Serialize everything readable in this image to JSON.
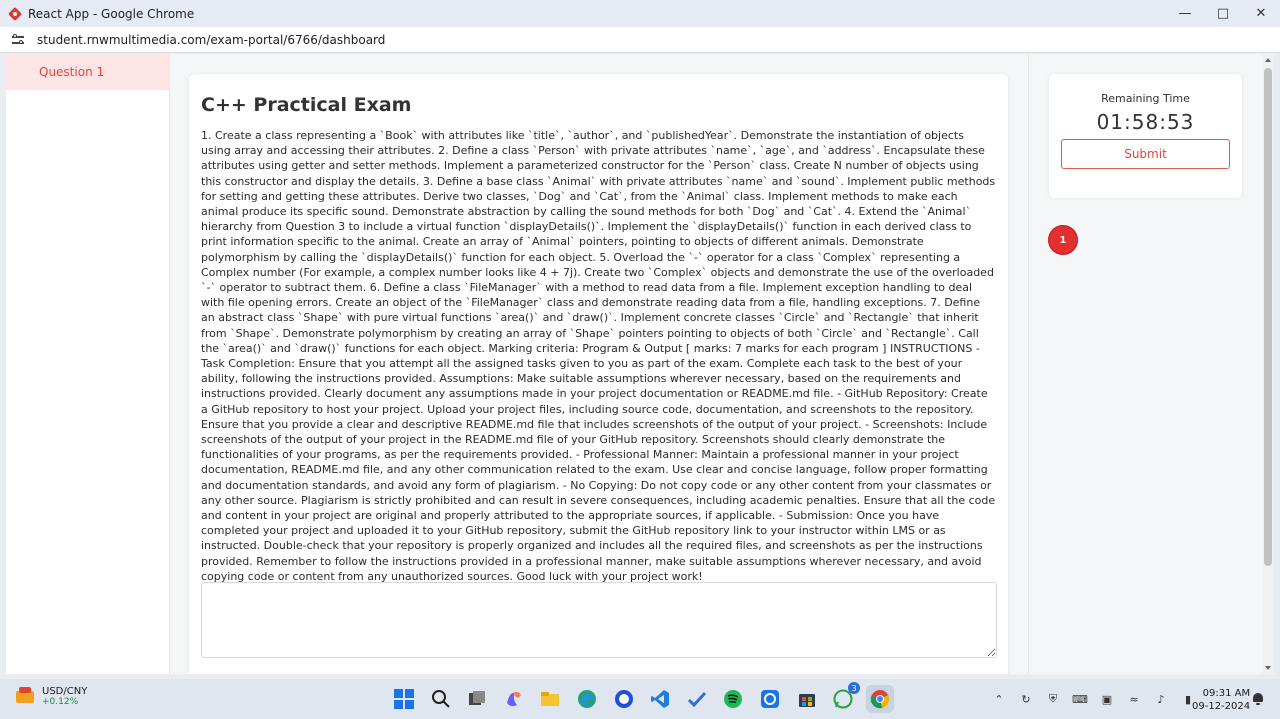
{
  "window": {
    "title": "React App - Google Chrome",
    "url": "student.rnwmultimedia.com/exam-portal/6766/dashboard"
  },
  "sidebar": {
    "items": [
      {
        "label": "Question 1"
      }
    ]
  },
  "exam": {
    "title": "C++ Practical Exam",
    "body": "1. Create a class representing a `Book` with attributes like `title`, `author`, and `publishedYear`. Demonstrate the instantiation of objects using array and accessing their attributes. 2. Define a class `Person` with private attributes `name`, `age`, and `address`. Encapsulate these attributes using getter and setter methods. Implement a parameterized constructor for the `Person` class. Create N number of objects using this constructor and display the details. 3. Define a base class `Animal` with private attributes `name` and `sound`. Implement public methods for setting and getting these attributes. Derive two classes, `Dog` and `Cat`, from the `Animal` class. Implement methods to make each animal produce its specific sound. Demonstrate abstraction by calling the sound methods for both `Dog` and `Cat`. 4. Extend the `Animal` hierarchy from Question 3 to include a virtual function `displayDetails()`. Implement the `displayDetails()` function in each derived class to print information specific to the animal. Create an array of `Animal` pointers, pointing to objects of different animals. Demonstrate polymorphism by calling the `displayDetails()` function for each object. 5. Overload the `-` operator for a class `Complex` representing a Complex number (For example, a complex number looks like 4 + 7j). Create two `Complex` objects and demonstrate the use of the overloaded `-` operator to subtract them. 6. Define a class `FileManager` with a method to read data from a file. Implement exception handling to deal with file opening errors. Create an object of the `FileManager` class and demonstrate reading data from a file, handling exceptions. 7. Define an abstract class `Shape` with pure virtual functions `area()` and `draw()`. Implement concrete classes `Circle` and `Rectangle` that inherit from `Shape`. Demonstrate polymorphism by creating an array of `Shape` pointers pointing to objects of both `Circle` and `Rectangle`. Call the `area()` and `draw()` functions for each object. Marking criteria: Program & Output [ marks: 7 marks for each program ] INSTRUCTIONS - Task Completion: Ensure that you attempt all the assigned tasks given to you as part of the exam. Complete each task to the best of your ability, following the instructions provided. Assumptions: Make suitable assumptions wherever necessary, based on the requirements and instructions provided. Clearly document any assumptions made in your project documentation or README.md file. - GitHub Repository: Create a GitHub repository to host your project. Upload your project files, including source code, documentation, and screenshots to the repository. Ensure that you provide a clear and descriptive README.md file that includes screenshots of the output of your project. - Screenshots: Include screenshots of the output of your project in the README.md file of your GitHub repository. Screenshots should clearly demonstrate the functionalities of your programs, as per the requirements provided. - Professional Manner: Maintain a professional manner in your project documentation, README.md file, and any other communication related to the exam. Use clear and concise language, follow proper formatting and documentation standards, and avoid any form of plagiarism. - No Copying: Do not copy code or any other content from your classmates or any other source. Plagiarism is strictly prohibited and can result in severe consequences, including academic penalties. Ensure that all the code and content in your project are original and properly attributed to the appropriate sources, if applicable. - Submission: Once you have completed your project and uploaded it to your GitHub repository, submit the GitHub repository link to your instructor within LMS or as instructed. Double-check that your repository is properly organized and includes all the required files, and screenshots as per the instructions provided. Remember to follow the instructions provided in a professional manner, make suitable assumptions wherever necessary, and avoid copying code or content from any unauthorized sources. Good luck with your project work!",
    "answer_value": ""
  },
  "timer": {
    "label": "Remaining Time",
    "value": "01:58:53",
    "submit_label": "Submit"
  },
  "question_nav": {
    "bubbles": [
      "1"
    ]
  },
  "taskbar": {
    "widget_title": "USD/CNY",
    "widget_change": "+0.12%",
    "whatsapp_badge": "3",
    "time": "09:31 AM",
    "date": "09-12-2024"
  },
  "colors": {
    "accent": "#e0463f",
    "sidebar_active_bg": "#fde5e5"
  }
}
